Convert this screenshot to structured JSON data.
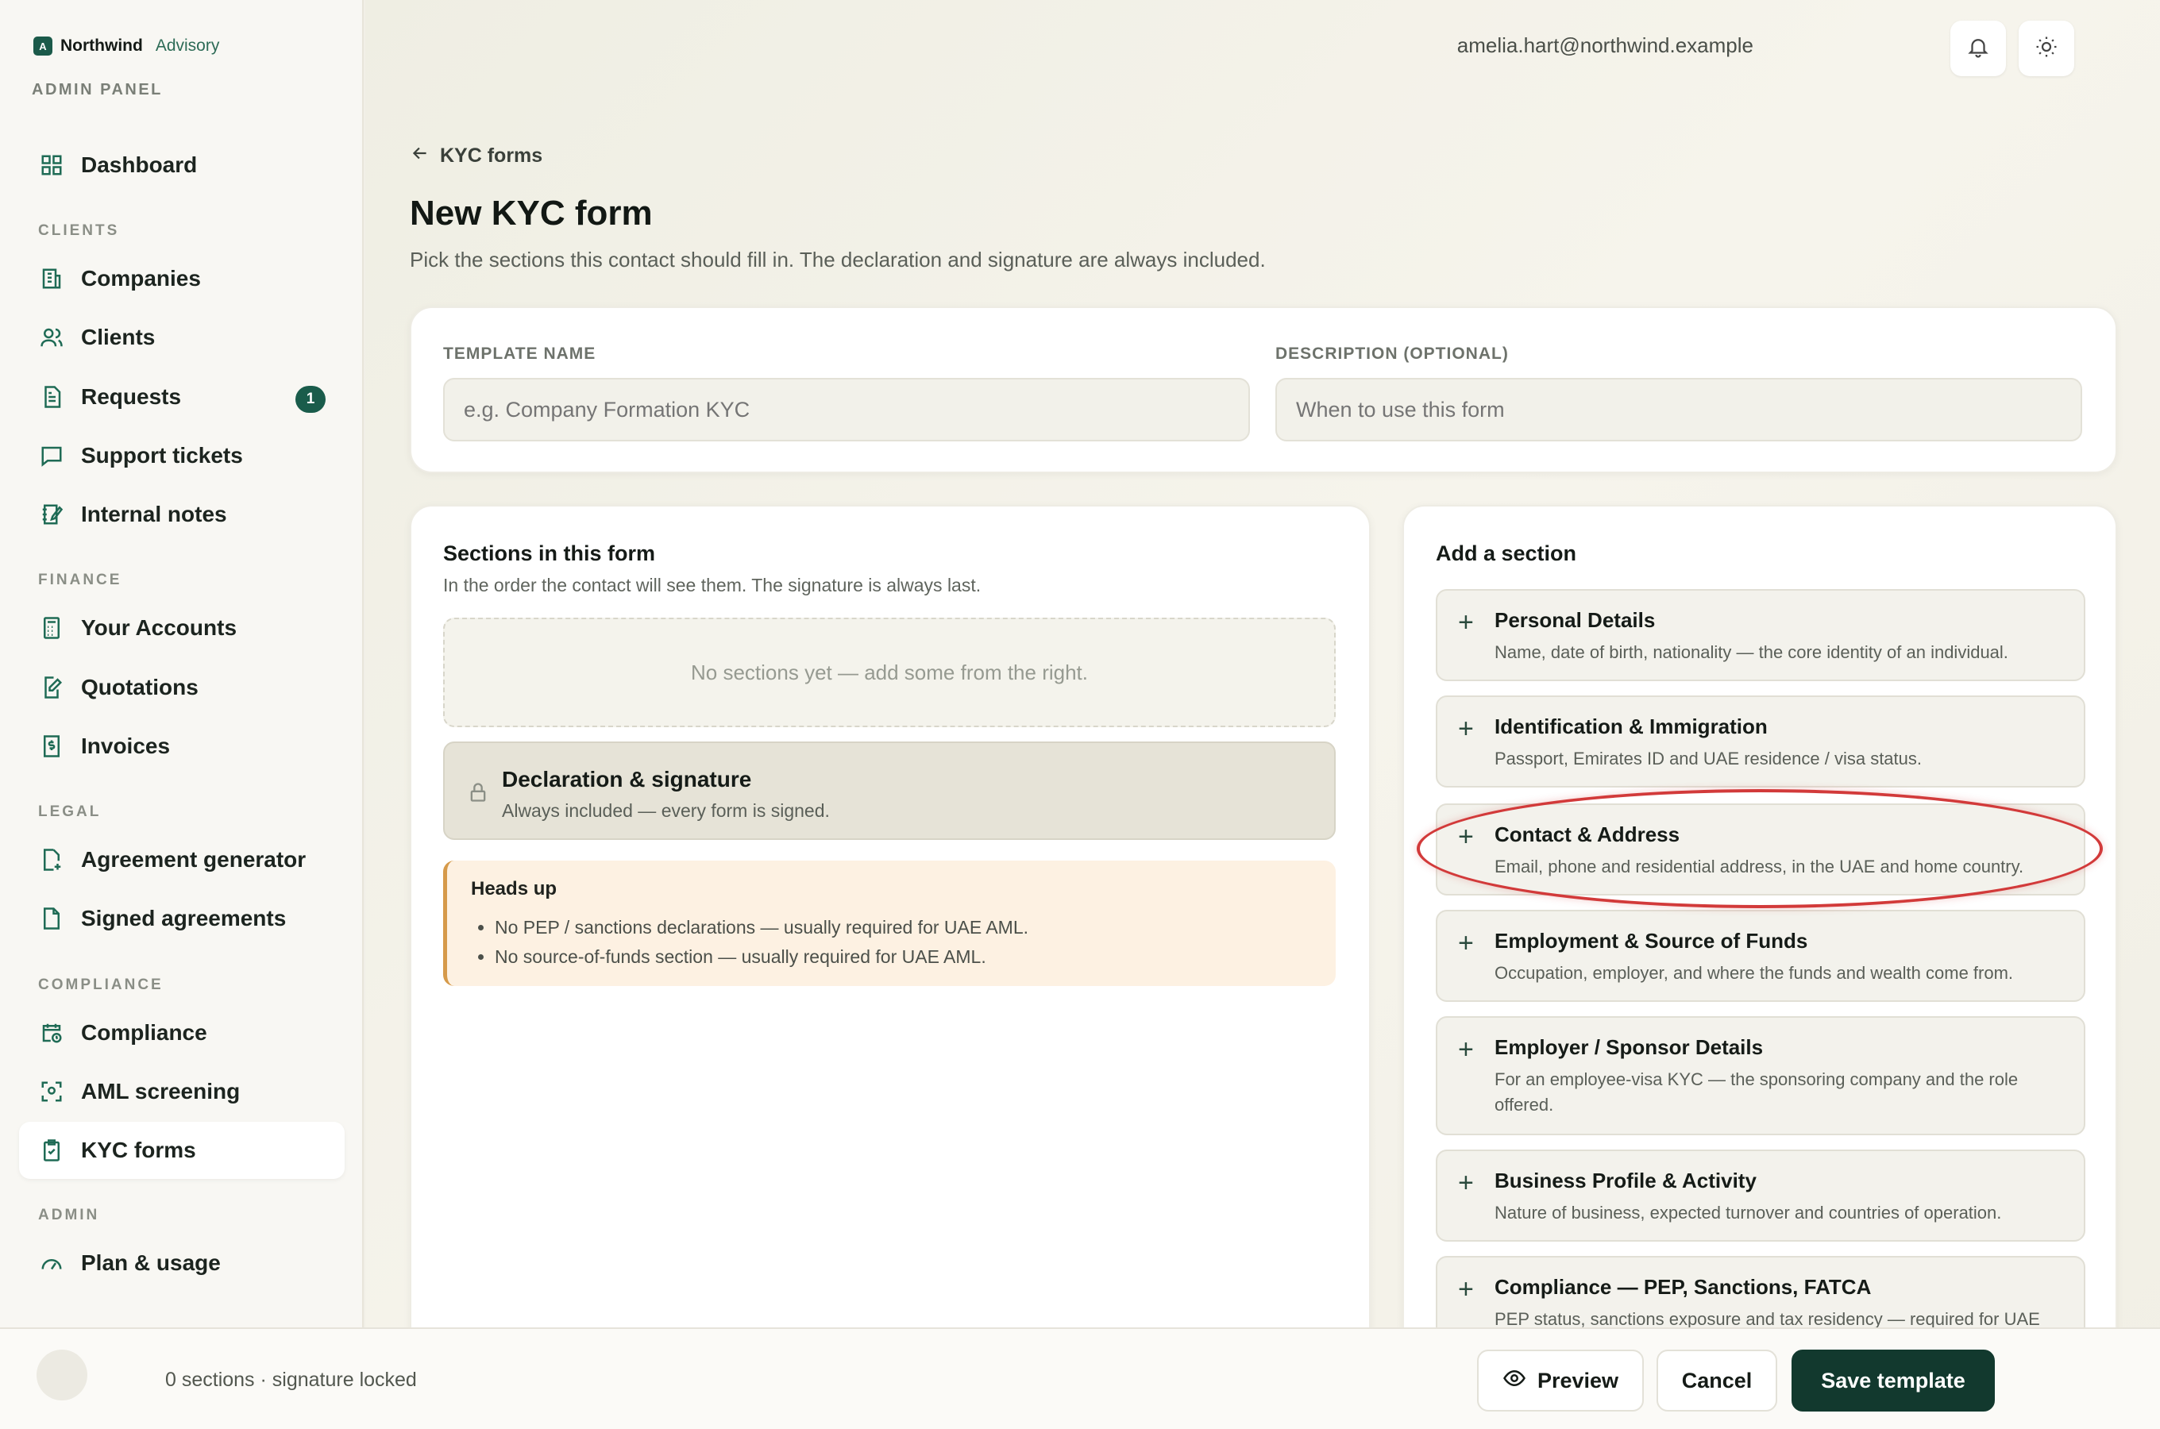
{
  "brand": {
    "name": "Northwind",
    "sub": "Advisory",
    "logo_letter": "A",
    "panel_label": "ADMIN PANEL"
  },
  "sidebar": {
    "sections": [
      "CLIENTS",
      "FINANCE",
      "LEGAL",
      "COMPLIANCE",
      "ADMIN"
    ],
    "items": [
      {
        "label": "Dashboard",
        "icon": "grid-icon"
      },
      {
        "label": "Companies",
        "icon": "building-icon"
      },
      {
        "label": "Clients",
        "icon": "users-icon"
      },
      {
        "label": "Requests",
        "icon": "document-icon",
        "badge": "1"
      },
      {
        "label": "Support tickets",
        "icon": "chat-icon"
      },
      {
        "label": "Internal notes",
        "icon": "note-icon"
      },
      {
        "label": "Your Accounts",
        "icon": "calculator-icon"
      },
      {
        "label": "Quotations",
        "icon": "edit-doc-icon"
      },
      {
        "label": "Invoices",
        "icon": "dollar-doc-icon"
      },
      {
        "label": "Agreement generator",
        "icon": "file-plus-icon"
      },
      {
        "label": "Signed agreements",
        "icon": "file-check-icon"
      },
      {
        "label": "Compliance",
        "icon": "calendar-clock-icon"
      },
      {
        "label": "AML screening",
        "icon": "scan-icon"
      },
      {
        "label": "KYC forms",
        "icon": "clipboard-check-icon",
        "active": true
      },
      {
        "label": "Plan & usage",
        "icon": "gauge-icon"
      }
    ]
  },
  "header": {
    "email": "amelia.hart@northwind.example"
  },
  "page": {
    "back_label": "KYC forms",
    "title": "New KYC form",
    "subtitle": "Pick the sections this contact should fill in. The declaration and signature are always included."
  },
  "template": {
    "name_label": "TEMPLATE NAME",
    "name_placeholder": "e.g. Company Formation KYC",
    "desc_label": "DESCRIPTION (OPTIONAL)",
    "desc_placeholder": "When to use this form"
  },
  "sections_panel": {
    "title": "Sections in this form",
    "subtitle": "In the order the contact will see them. The signature is always last.",
    "empty": "No sections yet — add some from the right.",
    "declaration_title": "Declaration & signature",
    "declaration_sub": "Always included — every form is signed.",
    "heads_up_title": "Heads up",
    "heads_up_items": [
      "No PEP / sanctions declarations — usually required for UAE AML.",
      "No source-of-funds section — usually required for UAE AML."
    ]
  },
  "add_panel": {
    "title": "Add a section",
    "options": [
      {
        "title": "Personal Details",
        "desc": "Name, date of birth, nationality — the core identity of an individual."
      },
      {
        "title": "Identification & Immigration",
        "desc": "Passport, Emirates ID and UAE residence / visa status."
      },
      {
        "title": "Contact & Address",
        "desc": "Email, phone and residential address, in the UAE and home country."
      },
      {
        "title": "Employment & Source of Funds",
        "desc": "Occupation, employer, and where the funds and wealth come from."
      },
      {
        "title": "Employer / Sponsor Details",
        "desc": "For an employee-visa KYC — the sponsoring company and the role offered."
      },
      {
        "title": "Business Profile & Activity",
        "desc": "Nature of business, expected turnover and countries of operation."
      },
      {
        "title": "Compliance — PEP, Sanctions, FATCA",
        "desc": "PEP status, sanctions exposure and tax residency — required for UAE"
      }
    ]
  },
  "footer": {
    "status": "0 sections · signature locked",
    "preview_label": "Preview",
    "cancel_label": "Cancel",
    "save_label": "Save template"
  }
}
